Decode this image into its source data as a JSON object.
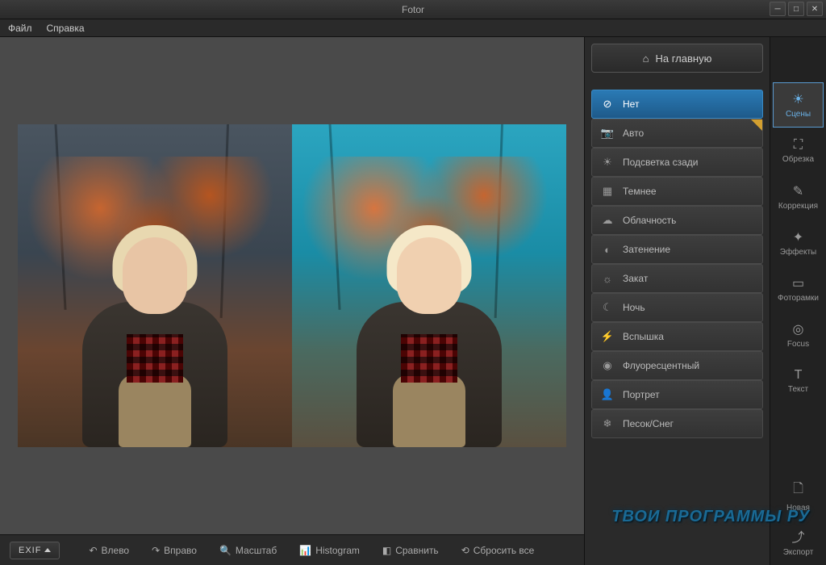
{
  "window": {
    "title": "Fotor"
  },
  "menubar": {
    "file": "Файл",
    "help": "Справка"
  },
  "home_button": "На главную",
  "scene_items": [
    {
      "label": "Нет",
      "icon": "⊘",
      "active": true
    },
    {
      "label": "Авто",
      "icon": "📷",
      "star": true
    },
    {
      "label": "Подсветка сзади",
      "icon": "☀"
    },
    {
      "label": "Темнее",
      "icon": "▦"
    },
    {
      "label": "Облачность",
      "icon": "☁"
    },
    {
      "label": "Затенение",
      "icon": "◐"
    },
    {
      "label": "Закат",
      "icon": "☼"
    },
    {
      "label": "Ночь",
      "icon": "☾"
    },
    {
      "label": "Вспышка",
      "icon": "⚡"
    },
    {
      "label": "Флуоресцентный",
      "icon": "◉"
    },
    {
      "label": "Портрет",
      "icon": "👤"
    },
    {
      "label": "Песок/Снег",
      "icon": "❄"
    }
  ],
  "right_tabs": [
    {
      "label": "Сцены",
      "icon": "☀",
      "active": true
    },
    {
      "label": "Обрезка",
      "icon": "⛶"
    },
    {
      "label": "Коррекция",
      "icon": "✎"
    },
    {
      "label": "Эффекты",
      "icon": "✦"
    },
    {
      "label": "Фоторамки",
      "icon": "▭"
    },
    {
      "label": "Focus",
      "icon": "◎"
    },
    {
      "label": "Текст",
      "icon": "T"
    }
  ],
  "right_tabs_bottom": [
    {
      "label": "Новая",
      "icon": "🗋"
    },
    {
      "label": "Экспорт",
      "icon": "⤴"
    }
  ],
  "bottom_toolbar": {
    "exif": "EXIF",
    "rotate_left": "Влево",
    "rotate_right": "Вправо",
    "zoom": "Масштаб",
    "histogram": "Histogram",
    "compare": "Сравнить",
    "reset": "Сбросить все"
  },
  "watermark": "ТВОИ ПРОГРАММЫ РУ"
}
